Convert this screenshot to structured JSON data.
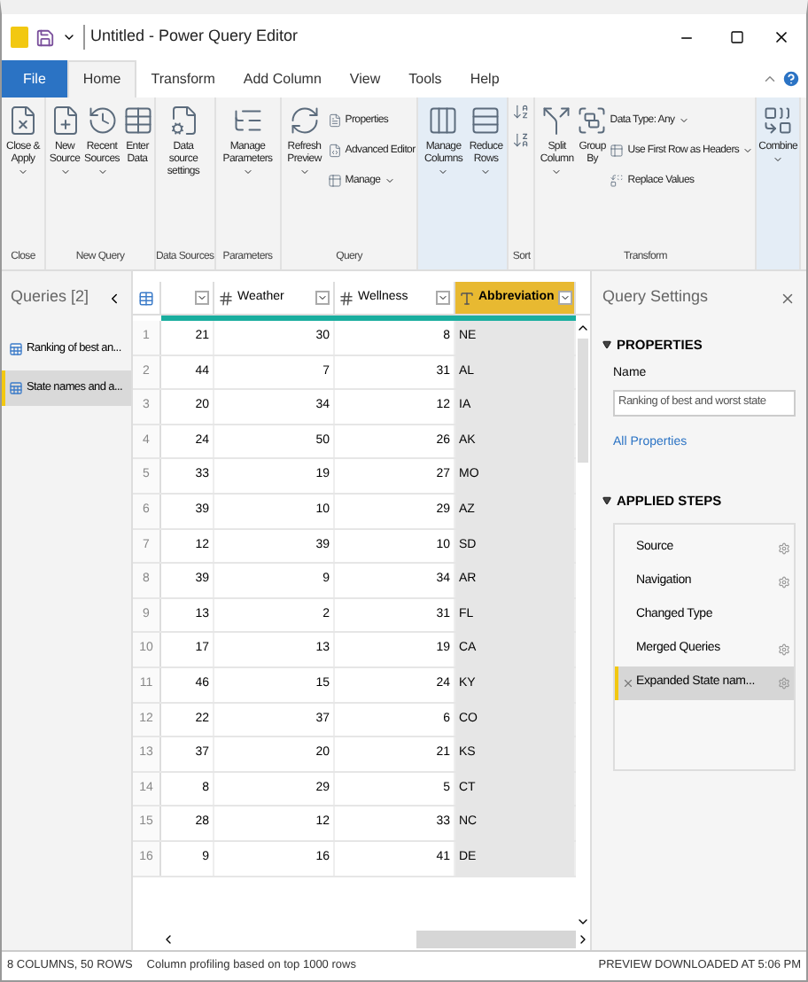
{
  "window": {
    "title": "Untitled - Power Query Editor"
  },
  "tabs": [
    {
      "label": "File",
      "kind": "file",
      "selected": false
    },
    {
      "label": "Home",
      "kind": "tab",
      "selected": true
    },
    {
      "label": "Transform",
      "kind": "tab",
      "selected": false
    },
    {
      "label": "Add Column",
      "kind": "tab",
      "selected": false
    },
    {
      "label": "View",
      "kind": "tab",
      "selected": false
    },
    {
      "label": "Tools",
      "kind": "tab",
      "selected": false
    },
    {
      "label": "Help",
      "kind": "tab",
      "selected": false
    }
  ],
  "ribbon": {
    "groups": [
      {
        "label": "Close",
        "shaded": false,
        "buttons": [
          {
            "label": "Close & Apply",
            "dropdown": true,
            "kind": "large"
          }
        ]
      },
      {
        "label": "New Query",
        "shaded": false,
        "buttons": [
          {
            "label": "New Source",
            "dropdown": true,
            "kind": "large"
          },
          {
            "label": "Recent Sources",
            "dropdown": true,
            "kind": "large"
          },
          {
            "label": "Enter Data",
            "dropdown": false,
            "kind": "large"
          }
        ]
      },
      {
        "label": "Data Sources",
        "shaded": false,
        "buttons": [
          {
            "label": "Data source settings",
            "dropdown": false,
            "kind": "large"
          }
        ]
      },
      {
        "label": "Parameters",
        "shaded": false,
        "buttons": [
          {
            "label": "Manage Parameters",
            "dropdown": true,
            "kind": "large"
          }
        ]
      },
      {
        "label": "Query",
        "shaded": false,
        "buttons": [
          {
            "label": "Refresh Preview",
            "dropdown": true,
            "kind": "large"
          },
          {
            "label": "Properties",
            "dropdown": false,
            "kind": "small"
          },
          {
            "label": "Advanced Editor",
            "dropdown": false,
            "kind": "small"
          },
          {
            "label": "Manage",
            "dropdown": true,
            "kind": "small"
          }
        ]
      },
      {
        "shaded": true,
        "buttons": [
          {
            "label": "Manage Columns",
            "dropdown": true,
            "kind": "large"
          },
          {
            "label": "Reduce Rows",
            "dropdown": true,
            "kind": "large"
          }
        ]
      },
      {
        "label": "Sort",
        "shaded": false,
        "buttons": [
          {
            "kind": "icon",
            "dropdown": false
          },
          {
            "kind": "icon",
            "dropdown": false
          }
        ]
      },
      {
        "label": "Transform",
        "shaded": false,
        "buttons": [
          {
            "label": "Split Column",
            "dropdown": true,
            "kind": "large"
          },
          {
            "label": "Group By",
            "dropdown": false,
            "kind": "large"
          },
          {
            "label": "Data Type: Any",
            "dropdown": true,
            "kind": "small"
          },
          {
            "label": "Use First Row as Headers",
            "dropdown": true,
            "kind": "small"
          },
          {
            "label": "Replace Values",
            "dropdown": false,
            "kind": "small"
          }
        ]
      },
      {
        "shaded": true,
        "buttons": [
          {
            "label": "Combine",
            "dropdown": true,
            "kind": "large"
          }
        ]
      }
    ]
  },
  "queries": {
    "title": "Queries [2]",
    "items": [
      {
        "label": "Ranking of best an...",
        "selected": false
      },
      {
        "label": "State names and a...",
        "selected": true
      }
    ]
  },
  "table": {
    "columns": [
      {
        "kind": "number",
        "type_icon": false,
        "selected": false
      },
      {
        "label": "Weather",
        "kind": "number",
        "type_icon": true,
        "selected": false
      },
      {
        "label": "Wellness",
        "kind": "number",
        "type_icon": true,
        "selected": false
      },
      {
        "label": "Abbreviation",
        "kind": "text",
        "type_icon": true,
        "selected": true
      }
    ],
    "rows": [
      {
        "number": "1",
        "cells": [
          "21",
          "30",
          "8",
          "NE"
        ]
      },
      {
        "number": "2",
        "cells": [
          "44",
          "7",
          "31",
          "AL"
        ]
      },
      {
        "number": "3",
        "cells": [
          "20",
          "34",
          "12",
          "IA"
        ]
      },
      {
        "number": "4",
        "cells": [
          "24",
          "50",
          "26",
          "AK"
        ]
      },
      {
        "number": "5",
        "cells": [
          "33",
          "19",
          "27",
          "MO"
        ]
      },
      {
        "number": "6",
        "cells": [
          "39",
          "10",
          "29",
          "AZ"
        ]
      },
      {
        "number": "7",
        "cells": [
          "12",
          "39",
          "10",
          "SD"
        ]
      },
      {
        "number": "8",
        "cells": [
          "39",
          "9",
          "34",
          "AR"
        ]
      },
      {
        "number": "9",
        "cells": [
          "13",
          "2",
          "31",
          "FL"
        ]
      },
      {
        "number": "10",
        "cells": [
          "17",
          "13",
          "19",
          "CA"
        ]
      },
      {
        "number": "11",
        "cells": [
          "46",
          "15",
          "24",
          "KY"
        ]
      },
      {
        "number": "12",
        "cells": [
          "22",
          "37",
          "6",
          "CO"
        ]
      },
      {
        "number": "13",
        "cells": [
          "37",
          "20",
          "21",
          "KS"
        ]
      },
      {
        "number": "14",
        "cells": [
          "8",
          "29",
          "5",
          "CT"
        ]
      },
      {
        "number": "15",
        "cells": [
          "28",
          "12",
          "33",
          "NC"
        ]
      },
      {
        "number": "16",
        "cells": [
          "9",
          "16",
          "41",
          "DE"
        ]
      }
    ]
  },
  "query_settings": {
    "title": "Query Settings",
    "properties": {
      "heading": "PROPERTIES",
      "name_label": "Name",
      "name_value": "Ranking of best and worst state",
      "link": "All Properties"
    },
    "applied_steps": {
      "heading": "APPLIED STEPS",
      "steps": [
        {
          "label": "Source",
          "settings": true,
          "selected": false
        },
        {
          "label": "Navigation",
          "settings": true,
          "selected": false
        },
        {
          "label": "Changed Type",
          "settings": false,
          "selected": false
        },
        {
          "label": "Merged Queries",
          "settings": true,
          "selected": false
        },
        {
          "label": "Expanded State nam...",
          "settings": true,
          "selected": true
        }
      ]
    }
  },
  "status_bar": {
    "left": [
      "8 COLUMNS, 50 ROWS",
      "Column profiling based on top 1000 rows"
    ],
    "right": "PREVIEW DOWNLOADED AT 5:06 PM"
  }
}
